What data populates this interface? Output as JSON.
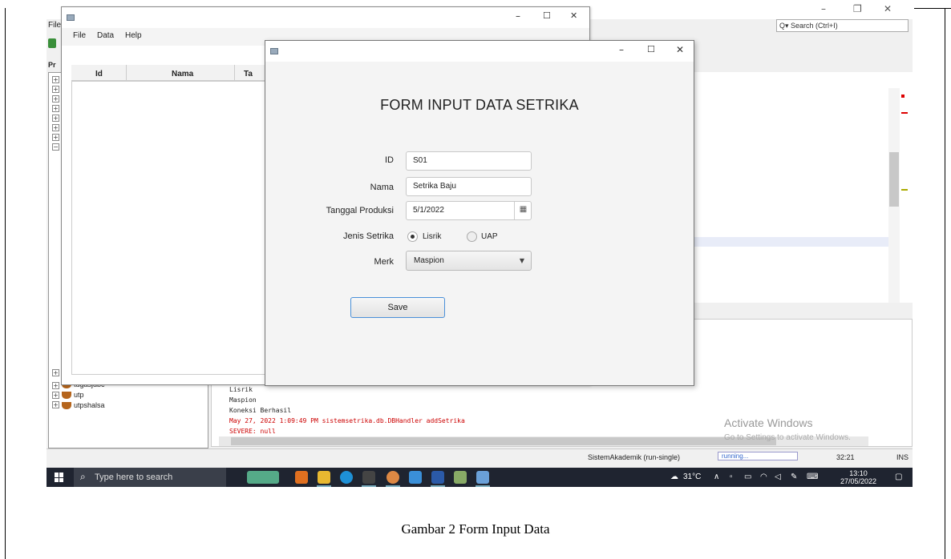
{
  "ide": {
    "search_placeholder": "Search (Ctrl+I)",
    "menu_file": "File",
    "projects_tab": "Pr",
    "projects": [
      {
        "label": "tugasjdbc"
      },
      {
        "label": "utp"
      },
      {
        "label": "utpshalsa"
      }
    ],
    "output_lines": [
      {
        "text": "Lisrik",
        "error": false
      },
      {
        "text": "Maspion",
        "error": false
      },
      {
        "text": "Koneksi Berhasil",
        "error": false
      },
      {
        "text": "May 27, 2022 1:09:49 PM sistemsetrika.db.DBHandler addSetrika",
        "error": true
      },
      {
        "text": "SEVERE: null",
        "error": true
      }
    ],
    "status": {
      "project": "SistemAkademik (run-single)",
      "progress": "running...",
      "position": "32:21",
      "mode": "INS"
    }
  },
  "activation": {
    "title": "Activate Windows",
    "subtitle": "Go to Settings to activate Windows."
  },
  "table_window": {
    "menu": [
      "File",
      "Data",
      "Help"
    ],
    "columns": [
      "Id",
      "Nama",
      "Ta"
    ]
  },
  "form": {
    "title": "FORM INPUT DATA SETRIKA",
    "id_label": "ID",
    "id_value": "S01",
    "nama_label": "Nama",
    "nama_value": "Setrika Baju",
    "tanggal_label": "Tanggal Produksi",
    "tanggal_value": "5/1/2022",
    "jenis_label": "Jenis Setrika",
    "jenis_options": [
      "Lisrik",
      "UAP"
    ],
    "jenis_selected": "Lisrik",
    "merk_label": "Merk",
    "merk_value": "Maspion",
    "save_label": "Save"
  },
  "taskbar": {
    "search_placeholder": "Type here to search",
    "weather": "31°C",
    "time": "13:10",
    "date": "27/05/2022"
  },
  "caption": "Gambar 2 Form Input Data",
  "colors": {
    "taskbar_bg": "#1f2430",
    "accent_blue": "#4a90d9",
    "error_red": "#c00000"
  }
}
